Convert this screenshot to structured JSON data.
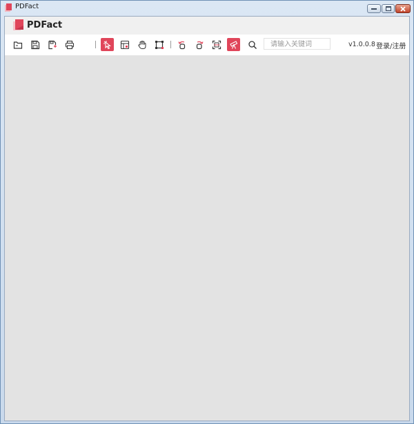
{
  "window": {
    "title": "PDFact"
  },
  "brand": {
    "name": "PDFact",
    "accent": "#e0455a"
  },
  "toolbar": {
    "items": [
      {
        "name": "open-folder-icon",
        "active": false
      },
      {
        "name": "save-icon",
        "active": false
      },
      {
        "name": "save-as-icon",
        "active": false
      },
      {
        "name": "print-icon",
        "active": false
      },
      {
        "name": "select-pointer-icon",
        "active": true
      },
      {
        "name": "layout-icon",
        "active": false
      },
      {
        "name": "hand-icon",
        "active": false
      },
      {
        "name": "crop-icon",
        "active": false
      },
      {
        "name": "rotate-left-icon",
        "active": false
      },
      {
        "name": "rotate-right-icon",
        "active": false
      },
      {
        "name": "scan-icon",
        "active": false
      },
      {
        "name": "telescope-icon",
        "active": true
      },
      {
        "name": "search-icon",
        "active": false
      }
    ],
    "search_placeholder": "请输入关键词",
    "version": "v1.0.0.8",
    "login_label": "登录/注册"
  }
}
